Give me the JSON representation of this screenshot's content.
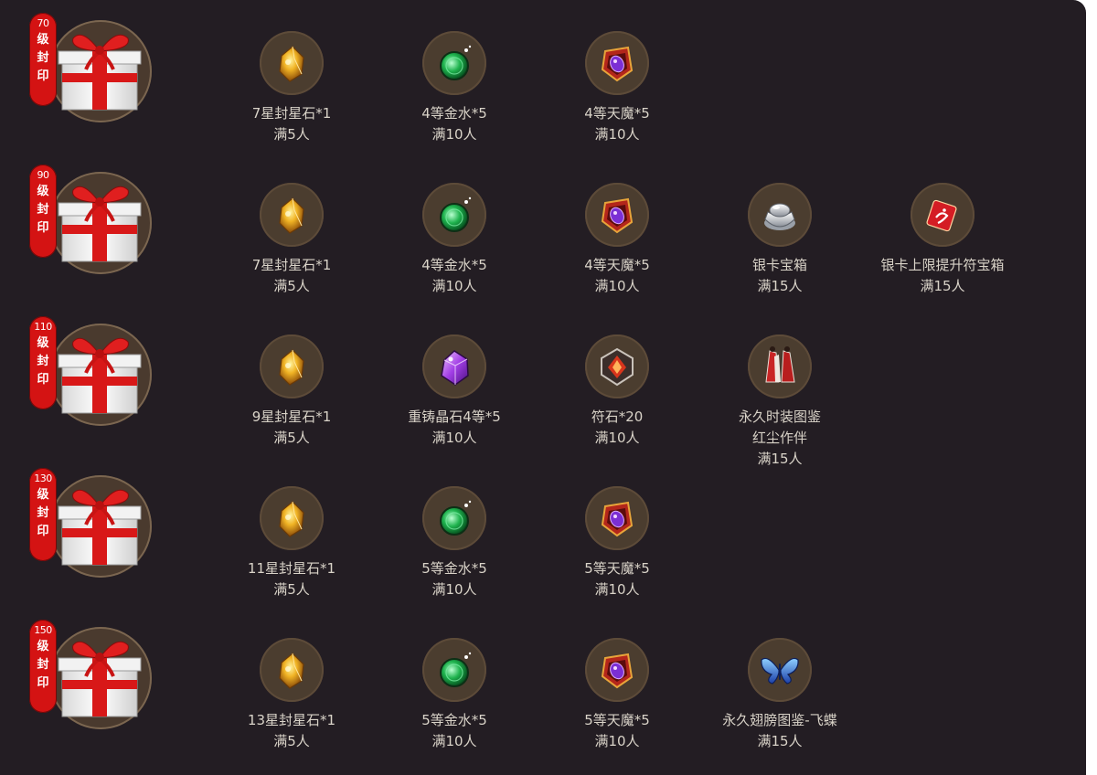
{
  "tiers": [
    {
      "level": "70",
      "seal_chars": [
        "级",
        "封",
        "印"
      ],
      "items": [
        {
          "icon": "seal-star-stone-icon",
          "name": "7星封星石*1",
          "requirement": "满5人"
        },
        {
          "icon": "gold-water-icon",
          "name": "4等金水*5",
          "requirement": "满10人"
        },
        {
          "icon": "heavenly-demon-icon",
          "name": "4等天魔*5",
          "requirement": "满10人"
        }
      ]
    },
    {
      "level": "90",
      "seal_chars": [
        "级",
        "封",
        "印"
      ],
      "items": [
        {
          "icon": "seal-star-stone-icon",
          "name": "7星封星石*1",
          "requirement": "满5人"
        },
        {
          "icon": "gold-water-icon",
          "name": "4等金水*5",
          "requirement": "满10人"
        },
        {
          "icon": "heavenly-demon-icon",
          "name": "4等天魔*5",
          "requirement": "满10人"
        },
        {
          "icon": "silver-ingot-chest-icon",
          "name": "银卡宝箱",
          "requirement": "满15人"
        },
        {
          "icon": "red-talisman-chest-icon",
          "name": "银卡上限提升符宝箱",
          "requirement": "满15人"
        }
      ]
    },
    {
      "level": "110",
      "seal_chars": [
        "级",
        "封",
        "印"
      ],
      "items": [
        {
          "icon": "seal-star-stone-icon",
          "name": "9星封星石*1",
          "requirement": "满5人"
        },
        {
          "icon": "recast-crystal-icon",
          "name": "重铸晶石4等*5",
          "requirement": "满10人"
        },
        {
          "icon": "rune-stone-icon",
          "name": "符石*20",
          "requirement": "满10人"
        },
        {
          "icon": "fashion-costume-icon",
          "name": "永久时装图鉴",
          "name2": "红尘作伴",
          "requirement": "满15人"
        }
      ]
    },
    {
      "level": "130",
      "seal_chars": [
        "级",
        "封",
        "印"
      ],
      "items": [
        {
          "icon": "seal-star-stone-icon",
          "name": "11星封星石*1",
          "requirement": "满5人"
        },
        {
          "icon": "gold-water-icon",
          "name": "5等金水*5",
          "requirement": "满10人"
        },
        {
          "icon": "heavenly-demon-icon",
          "name": "5等天魔*5",
          "requirement": "满10人"
        }
      ]
    },
    {
      "level": "150",
      "seal_chars": [
        "级",
        "封",
        "印"
      ],
      "items": [
        {
          "icon": "seal-star-stone-icon",
          "name": "13星封星石*1",
          "requirement": "满5人"
        },
        {
          "icon": "gold-water-icon",
          "name": "5等金水*5",
          "requirement": "满10人"
        },
        {
          "icon": "heavenly-demon-icon",
          "name": "5等天魔*5",
          "requirement": "满10人"
        },
        {
          "icon": "butterfly-wings-icon",
          "name": "永久翅膀图鉴-飞蝶",
          "requirement": "满15人"
        }
      ]
    }
  ],
  "colors": {
    "background": "#231d23",
    "badge": "#d41313",
    "text": "#d9d3c8",
    "icon_ring": "#4b3d2f"
  }
}
